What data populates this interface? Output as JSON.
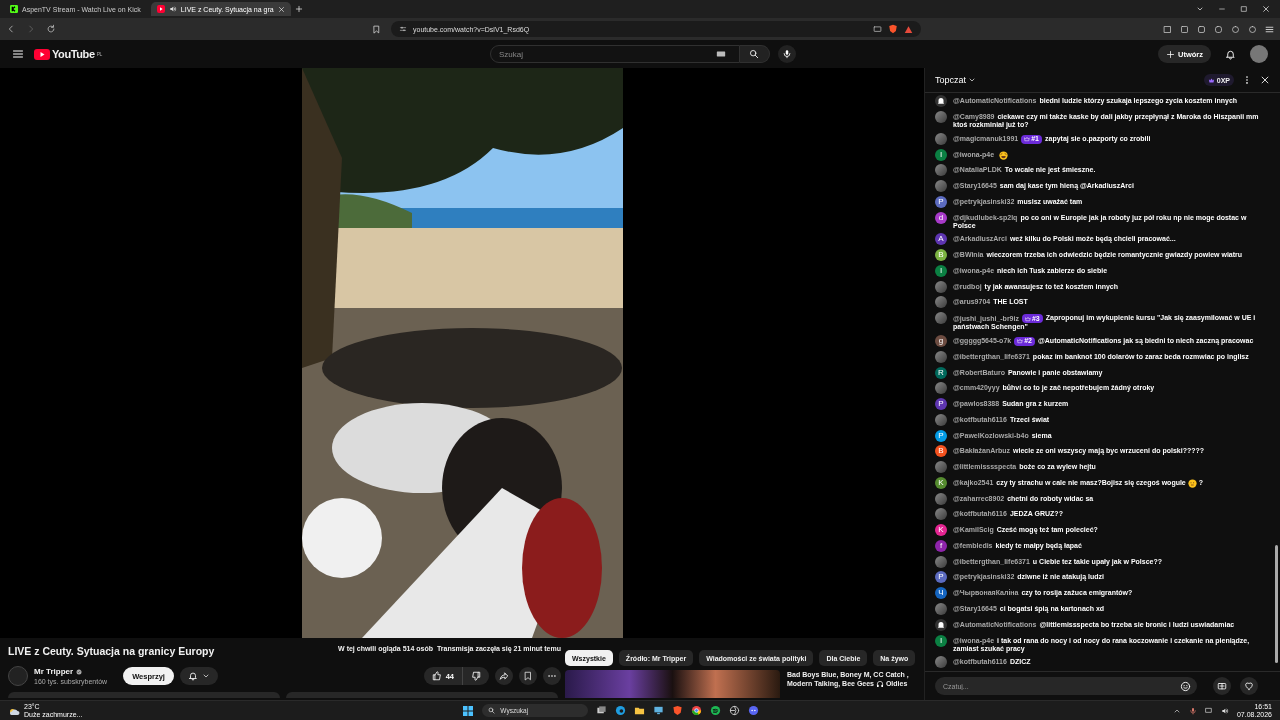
{
  "browser": {
    "tabs": [
      {
        "title": "AspenTV Stream - Watch Live on Kick",
        "selected": false
      },
      {
        "title": "LIVE z Ceuty. Sytuacja na gra",
        "selected": true
      }
    ],
    "url": "youtube.com/watch?v=DslV1_Rsd6Q"
  },
  "header": {
    "logo": "YouTube",
    "region": "PL",
    "search_placeholder": "Szukaj",
    "create": "Utwórz"
  },
  "video_info": {
    "title": "LIVE z Ceuty. Sytuacja na granicy Europy",
    "stats": "W tej chwili ogląda 514 osób  Transmisja zaczęła się 21 minut temu",
    "channel": "Mr Tripper",
    "verified": true,
    "subscribers": "160 tys. subskrybentów",
    "support": "Wesprzyj",
    "likes": "44",
    "chips": [
      {
        "label": "Wszystkie",
        "selected": true
      },
      {
        "label": "Źródło: Mr Tripper",
        "selected": false
      },
      {
        "label": "Wiadomości ze świata polityki",
        "selected": false
      },
      {
        "label": "Dla Ciebie",
        "selected": false
      },
      {
        "label": "Na żywo",
        "selected": false
      }
    ],
    "recommended": {
      "title": "Bad Boys Blue, Boney M, CC Catch , Modern Talking, Bee Gees",
      "title_end": "Oldies"
    }
  },
  "chat": {
    "title": "Topczat",
    "xp": "0XP",
    "input_placeholder": "Czatuj...",
    "messages": [
      {
        "user": "@AutomaticNotifications",
        "avatar": {
          "kind": "bell"
        },
        "text": "biedni ludzie którzy szukaja lepszego zycia kosztem innych"
      },
      {
        "user": "@Camy8989",
        "avatar": {
          "kind": "image"
        },
        "text": "ciekawe czy mi także kaske by dali jakby przepłynął z Maroka do Hiszpanii mm ktoś rozkminiał już to?"
      },
      {
        "user": "@magicmanuk1991",
        "avatar": {
          "kind": "image"
        },
        "badge": "#1",
        "text": "zapytaj sie o.pazporty co zrobili"
      },
      {
        "user": "@iwona-p4e",
        "avatar": {
          "kind": "letter",
          "letter": "I",
          "color": "#0b8043"
        },
        "emoji": {
          "kind": "laugh"
        }
      },
      {
        "user": "@NataliaPLDK",
        "avatar": {
          "kind": "image"
        },
        "text": "To wcale nie jest śmieszne."
      },
      {
        "user": "@Stary16645",
        "avatar": {
          "kind": "image"
        },
        "text": "sam daj kase tym hieną @ArkadiuszArci"
      },
      {
        "user": "@petrykjasinski32",
        "avatar": {
          "kind": "letter",
          "letter": "P",
          "color": "#5c6bc0"
        },
        "text": "musisz uważać tam"
      },
      {
        "user": "@djkudlubek-sp2lq",
        "avatar": {
          "kind": "letter",
          "letter": "d",
          "color": "#a83ac9"
        },
        "text": "po co oni w Europie jak ja roboty juz pół roku np nie moge dostac w Polsce"
      },
      {
        "user": "@ArkadiuszArci",
        "avatar": {
          "kind": "letter",
          "letter": "A",
          "color": "#5e35b1"
        },
        "text": "weź kilku do Polski może będą chcieli pracować..."
      },
      {
        "user": "@BWinia",
        "avatar": {
          "kind": "letter",
          "letter": "B",
          "color": "#7cb342"
        },
        "text": "wieczorem trzeba ich odwiedzic będzie romantycznie gwiazdy powiew wiatru"
      },
      {
        "user": "@iwona-p4e",
        "avatar": {
          "kind": "letter",
          "letter": "I",
          "color": "#0b8043"
        },
        "text": "niech ich Tusk zabierze do siebie"
      },
      {
        "user": "@rudboj",
        "avatar": {
          "kind": "image"
        },
        "text": "ty jak awansujesz to też kosztem innych"
      },
      {
        "user": "@arus9704",
        "avatar": {
          "kind": "image"
        },
        "text": "THE LOST"
      },
      {
        "user": "@jushi_jushi_-br9iz",
        "avatar": {
          "kind": "image"
        },
        "badge": "#3",
        "text": "Zaproponuj im wykupienie kursu \"Jak się zaasymilować w UE i państwach Schengen\""
      },
      {
        "user": "@ggggg5645-o7k",
        "avatar": {
          "kind": "letter",
          "letter": "g",
          "color": "#6d4c41"
        },
        "badge": "#2",
        "text": "@AutomaticNotifications jak są biedni to niech zaczną pracowac"
      },
      {
        "user": "@ibettergthan_life6371",
        "avatar": {
          "kind": "image"
        },
        "text": "pokaz im banknot 100 dolarów to zaraz beda rozmwiac po inglisz"
      },
      {
        "user": "@RobertBaturo",
        "avatar": {
          "kind": "letter",
          "letter": "R",
          "color": "#00695c"
        },
        "text": "Panowie i panie obstawiamy"
      },
      {
        "user": "@cmm420yyy",
        "avatar": {
          "kind": "image"
        },
        "text": "bůhví co to je zač nepotřebujem žádný otroky"
      },
      {
        "user": "@pawlos8388",
        "avatar": {
          "kind": "letter",
          "letter": "P",
          "color": "#5e35b1"
        },
        "text": "Sudan gra z kurzem"
      },
      {
        "user": "@kotfbutah6116",
        "avatar": {
          "kind": "image"
        },
        "text": "Trzeci świat"
      },
      {
        "user": "@PawelKozlowski-b4o",
        "avatar": {
          "kind": "letter",
          "letter": "P",
          "color": "#039be5"
        },
        "text": "siema"
      },
      {
        "user": "@BakłażanArbuz",
        "avatar": {
          "kind": "letter",
          "letter": "B",
          "color": "#f4511e"
        },
        "text": "wiecie ze oni wszyscy mają byc wrzuceni do polski?????"
      },
      {
        "user": "@littlemisssspecta",
        "avatar": {
          "kind": "image"
        },
        "text": "boże co za wylew hejtu"
      },
      {
        "user": "@kajko2541",
        "avatar": {
          "kind": "letter",
          "letter": "K",
          "color": "#558b2f"
        },
        "text": "czy ty strachu w cale nie masz?Bojisz się czegoś wogule",
        "emoji": {
          "kind": "think"
        },
        "text_end": "?"
      },
      {
        "user": "@zaharrec8902",
        "avatar": {
          "kind": "image"
        },
        "text": "chetni do roboty widac sa"
      },
      {
        "user": "@kotfbutah6116",
        "avatar": {
          "kind": "image"
        },
        "text": "JEDZA GRUZ??"
      },
      {
        "user": "@KamilScig",
        "avatar": {
          "kind": "letter",
          "letter": "K",
          "color": "#e52592"
        },
        "text": "Cześć mogę też tam polecieć?"
      },
      {
        "user": "@fembledis",
        "avatar": {
          "kind": "letter",
          "letter": "f",
          "color": "#8e24aa"
        },
        "text": "kiedy te małpy będą łapać"
      },
      {
        "user": "@ibettergthan_life6371",
        "avatar": {
          "kind": "image"
        },
        "text": "u Ciebie tez takie upały jak w Polsce??"
      },
      {
        "user": "@petrykjasinski32",
        "avatar": {
          "kind": "letter",
          "letter": "P",
          "color": "#5c6bc0"
        },
        "text": "dziwne iż nie atakują ludzi"
      },
      {
        "user": "@ЧырвонаяКаліна",
        "avatar": {
          "kind": "letter",
          "letter": "Ч",
          "color": "#1565c0"
        },
        "text": "czy to rosija zażuca emigrantów?"
      },
      {
        "user": "@Stary16645",
        "avatar": {
          "kind": "image"
        },
        "text": "ci bogatsi śpią na kartonach xd"
      },
      {
        "user": "@AutomaticNotifications",
        "avatar": {
          "kind": "bell"
        },
        "text": "@littlemissspecta bo trzeba sie bronic i ludzi uswiadamiac"
      },
      {
        "user": "@iwona-p4e",
        "avatar": {
          "kind": "letter",
          "letter": "I",
          "color": "#0b8043"
        },
        "text": "i tak od rana do nocy i od nocy do rana koczowanie i czekanie na pieniądze, zamiast szukać pracy"
      },
      {
        "user": "@kotfbutah6116",
        "avatar": {
          "kind": "image"
        },
        "text": "DZICZ"
      }
    ]
  },
  "taskbar": {
    "temperature": "23°C",
    "weather": "Duże zachmurze...",
    "search_placeholder": "Wyszukaj",
    "time": "16:51",
    "date": "07.08.2026"
  }
}
